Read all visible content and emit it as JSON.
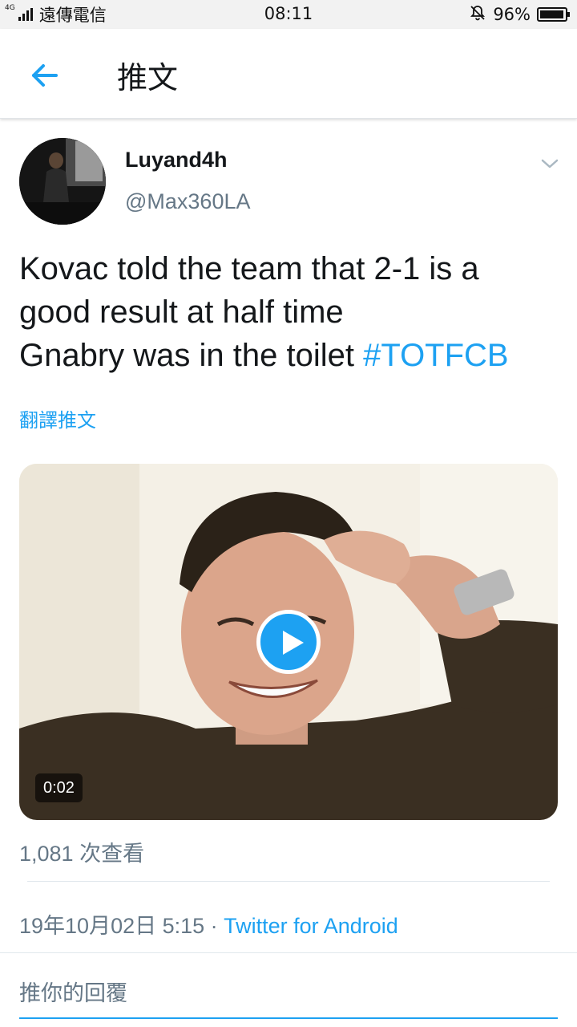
{
  "status_bar": {
    "network": "4G",
    "carrier": "遠傳電信",
    "time": "08:11",
    "battery": "96%",
    "battery_level": 0.96,
    "icons": [
      "signal-icon",
      "muted-bell-icon",
      "battery-icon"
    ]
  },
  "header": {
    "title": "推文",
    "back_icon": "back-arrow-icon"
  },
  "tweet": {
    "display_name": "Luyand4h",
    "handle": "@Max360LA",
    "text": "Kovac told the team that 2-1 is a\ngood result  at half time\nGnabry was in the toilet ",
    "hashtag": "#TOTFCB",
    "translate_label": "翻譯推文",
    "media": {
      "duration": "0:02",
      "play_icon": "play-icon"
    },
    "views": "1,081 次查看",
    "date": "19年10月02日 5:15",
    "separator": " · ",
    "source": "Twitter for Android"
  },
  "reply": {
    "placeholder": "推你的回覆"
  },
  "colors": {
    "accent": "#1da1f2",
    "text": "#14171a",
    "secondary": "#657786"
  }
}
